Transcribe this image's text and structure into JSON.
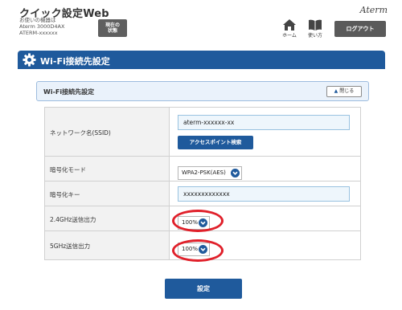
{
  "header": {
    "app_title": "クイック設定Web",
    "device_caption": "お使いの機器は",
    "device_model": "Aterm 3000D4AX",
    "device_name": "ATERM-xxxxxx",
    "status_button_line1": "現在の",
    "status_button_line2": "状態",
    "brand": "Aterm",
    "home_label": "ホーム",
    "manual_label": "使い方",
    "logout_label": "ログアウト"
  },
  "page": {
    "title": "Wi-Fi接続先設定"
  },
  "section": {
    "title": "Wi-Fi接続先設定",
    "collapse_label": "閉じる"
  },
  "form": {
    "ssid_label": "ネットワーク名(SSID)",
    "ssid_value": "aterm-xxxxxx-xx",
    "ap_search_label": "アクセスポイント検索",
    "encryption_label": "暗号化モード",
    "encryption_value": "WPA2-PSK(AES)",
    "key_label": "暗号化キー",
    "key_value": "xxxxxxxxxxxxx",
    "power24_label": "2.4GHz送信出力",
    "power24_value": "100%",
    "power5_label": "5GHz送信出力",
    "power5_value": "100%"
  },
  "submit_label": "設定",
  "colors": {
    "primary": "#1f5a9c",
    "highlight": "#e0202a",
    "dark_button": "#5a5a5a"
  }
}
